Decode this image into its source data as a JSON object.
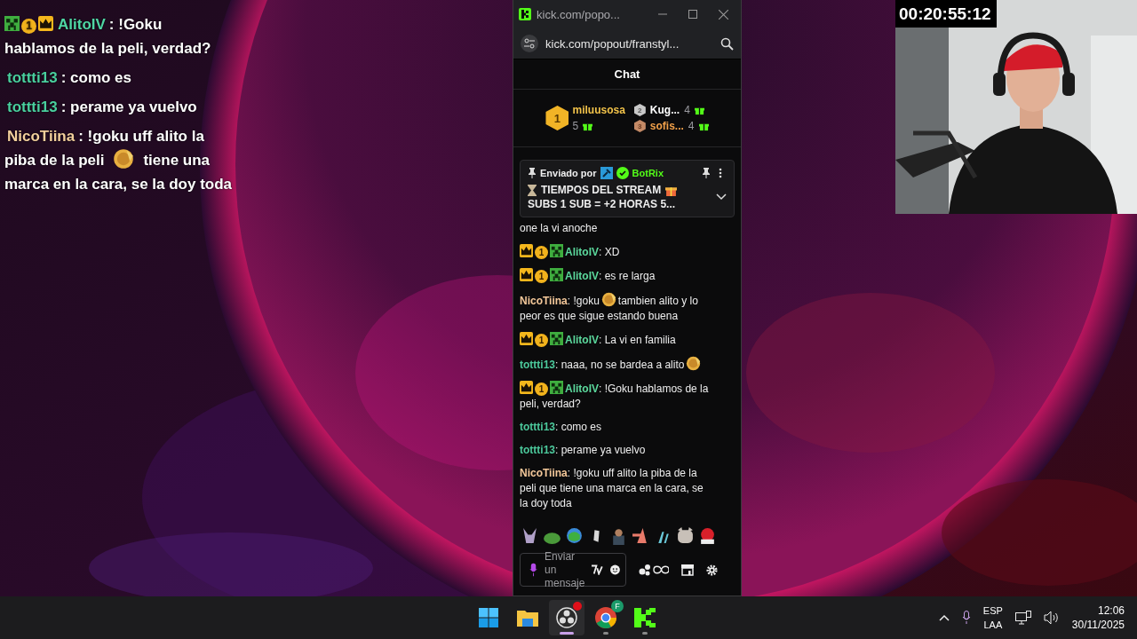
{
  "overlay_chat": {
    "messages": [
      {
        "badges": [
          {
            "kind": "creeper"
          },
          {
            "kind": "sub",
            "text": "1"
          },
          {
            "kind": "crown"
          }
        ],
        "user": "AlitoIV",
        "color": "#4fd6a4",
        "lines": [
          [
            {
              "kind": "text",
              "text": ": !Goku"
            }
          ],
          [
            {
              "kind": "text",
              "text": "hablamos de la peli, verdad?"
            }
          ]
        ]
      },
      {
        "user": "tottti13",
        "color": "#49cf9e",
        "lines": [
          [
            {
              "kind": "text",
              "text": ": como es"
            }
          ]
        ]
      },
      {
        "user": "tottti13",
        "color": "#49cf9e",
        "lines": [
          [
            {
              "kind": "text",
              "text": ": perame ya vuelvo"
            }
          ]
        ]
      },
      {
        "user": "NicoTiina",
        "color": "#f2cf9c",
        "lines": [
          [
            {
              "kind": "text",
              "text": ": !goku uff alito la"
            }
          ],
          [
            {
              "kind": "text",
              "text": "piba de la peli"
            },
            {
              "kind": "emote"
            },
            {
              "kind": "text",
              "text": "tiene una"
            }
          ],
          [
            {
              "kind": "text",
              "text": "marca en la cara, se la doy toda"
            }
          ]
        ]
      }
    ]
  },
  "popup": {
    "title": "kick.com/popo...",
    "address": "kick.com/popout/franstyl...",
    "header": "Chat",
    "leaderboard": [
      {
        "rank": "1",
        "name": "miluusosa",
        "count": "5",
        "color": "#f1c24a"
      },
      {
        "rank": "2",
        "name": "Kug...",
        "count": "4",
        "color": "#ffffff"
      },
      {
        "rank": "3",
        "name": "sofis...",
        "count": "4",
        "color": "#f0a04a"
      }
    ],
    "pinned": {
      "label": "Enviado por",
      "user": "BotRix",
      "title": "TIEMPOS DEL STREAM",
      "text": "SUBS 1 SUB = +2 HORAS 5..."
    },
    "messages": [
      {
        "lines": [
          [
            {
              "kind": "text",
              "text": "one la vi anoche"
            }
          ]
        ]
      },
      {
        "badges": [
          {
            "kind": "crown"
          },
          {
            "kind": "sub",
            "text": "1"
          },
          {
            "kind": "creeper"
          }
        ],
        "user": "AlitoIV",
        "color": "#5bd89c",
        "lines": [
          [
            {
              "kind": "text",
              "text": ": XD"
            }
          ]
        ]
      },
      {
        "badges": [
          {
            "kind": "crown"
          },
          {
            "kind": "sub",
            "text": "1"
          },
          {
            "kind": "creeper"
          }
        ],
        "user": "AlitoIV",
        "color": "#5bd89c",
        "lines": [
          [
            {
              "kind": "text",
              "text": ": es re larga"
            }
          ]
        ]
      },
      {
        "user": "NicoTiina",
        "color": "#f4c89a",
        "lines": [
          [
            {
              "kind": "text",
              "text": ": !goku"
            },
            {
              "kind": "emote"
            },
            {
              "kind": "text",
              "text": "tambien alito y lo"
            }
          ],
          [
            {
              "kind": "text",
              "text": "peor es que sigue estando buena"
            }
          ]
        ]
      },
      {
        "badges": [
          {
            "kind": "crown"
          },
          {
            "kind": "sub",
            "text": "1"
          },
          {
            "kind": "creeper"
          }
        ],
        "user": "AlitoIV",
        "color": "#5bd89c",
        "lines": [
          [
            {
              "kind": "text",
              "text": ": La vi en familia"
            }
          ]
        ]
      },
      {
        "user": "tottti13",
        "color": "#4cc99c",
        "lines": [
          [
            {
              "kind": "text",
              "text": ": naaa, no se bardea a alito"
            },
            {
              "kind": "emote"
            }
          ]
        ]
      },
      {
        "badges": [
          {
            "kind": "crown"
          },
          {
            "kind": "sub",
            "text": "1"
          },
          {
            "kind": "creeper"
          }
        ],
        "user": "AlitoIV",
        "color": "#5bd89c",
        "lines": [
          [
            {
              "kind": "text",
              "text": ": !Goku hablamos de la"
            }
          ],
          [
            {
              "kind": "text",
              "text": "peli, verdad?"
            }
          ]
        ]
      },
      {
        "user": "tottti13",
        "color": "#4cc99c",
        "lines": [
          [
            {
              "kind": "text",
              "text": ": como es"
            }
          ]
        ]
      },
      {
        "user": "tottti13",
        "color": "#4cc99c",
        "lines": [
          [
            {
              "kind": "text",
              "text": ": perame ya vuelvo"
            }
          ]
        ]
      },
      {
        "user": "NicoTiina",
        "color": "#f4c89a",
        "lines": [
          [
            {
              "kind": "text",
              "text": ": !goku uff alito la piba de la"
            }
          ],
          [
            {
              "kind": "text",
              "text": "peli que tiene una marca en la cara, se"
            }
          ],
          [
            {
              "kind": "text",
              "text": "la doy toda"
            }
          ]
        ]
      }
    ],
    "input": {
      "placeholder": "Enviar un mensaje"
    }
  },
  "webcam": {
    "timer": "00:20:55:12"
  },
  "taskbar": {
    "apps": [
      {
        "kind": "start",
        "selected": false,
        "running": false
      },
      {
        "kind": "folder",
        "selected": false,
        "running": false
      },
      {
        "kind": "obs",
        "selected": true,
        "running": true,
        "alert": true
      },
      {
        "kind": "chrome",
        "selected": false,
        "running": true,
        "badge": "F"
      },
      {
        "kind": "kick",
        "selected": false,
        "running": true
      }
    ],
    "language": [
      "ESP",
      "LAA"
    ],
    "time": "12:06",
    "date": "30/11/2025"
  }
}
